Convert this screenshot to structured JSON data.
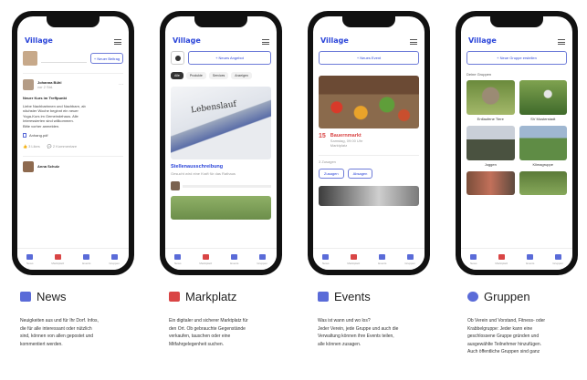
{
  "brand": {
    "logo": "Village",
    "accent": "#2b45d9",
    "red": "#d94545"
  },
  "tabs": [
    "News",
    "Marktplatz",
    "Events",
    "Gruppen"
  ],
  "phone1": {
    "composer_button": "+ Neuer Beitrag",
    "post": {
      "author": "Johanna Bühl",
      "time": "vor 2 Std.",
      "title": "Neuer Kurs im Treffpunkt",
      "lines": [
        "Liebe Nachbarinnen und Nachbarn, ab",
        "nächster Woche beginnt ein neuer",
        "Yoga-Kurs im Gemeindehaus. Alle",
        "Interessierten sind willkommen.",
        "Bitte vorher anmelden."
      ],
      "attachment": "Anhang.pdf",
      "likes": "3 Likes",
      "comments": "2 Kommentare"
    },
    "post2_author": "Anna Schulz"
  },
  "phone2": {
    "new_button": "+ Neues Angebot",
    "chips": [
      "Alle",
      "Produkte",
      "Services",
      "Anzeigen"
    ],
    "photo_sign": "Lebenslauf",
    "card_title": "Stellenausschreibung",
    "card_sub": "Gesucht wird eine Kraft für das Rathaus"
  },
  "phone3": {
    "new_button": "+ Neues Event",
    "event_day": "15",
    "event_title": "Bauernmarkt",
    "event_meta": [
      "Samstag, 09:00 Uhr",
      "Marktplatz"
    ],
    "attendees": "3 Zusagen",
    "btn_yes": "Zusagen",
    "btn_no": "Absagen"
  },
  "phone4": {
    "new_button": "+ Neue Gruppe erstellen",
    "section_label": "Deine Gruppen",
    "groups": [
      "Entlaufene Tiere",
      "SV Musterstadt",
      "Joggen",
      "Klimagruppe",
      "",
      ""
    ]
  },
  "sections": [
    {
      "title": "News",
      "text": [
        "Neuigkeiten aus und für Ihr Dorf. Infos,",
        "die für alle interessant oder nützlich",
        "sind, können von allen gepostet und",
        "kommentiert werden."
      ]
    },
    {
      "title": "Markplatz",
      "text": [
        "Ein digitaler und sicherer Marktplatz für",
        "den Ort. Ob gebrauchte Gegenstände",
        "verkaufen, tauschen oder eine",
        "Mitfahrgelegenheit suchen."
      ]
    },
    {
      "title": "Events",
      "text": [
        "Was ist wann und wo los?",
        "Jeder Verein, jede Gruppe und auch die",
        "Verwaltung können ihre Events teilen,",
        "alle können zusagen."
      ]
    },
    {
      "title": "Gruppen",
      "text": [
        "Ob Verein und Vorstand, Fitness- oder",
        "Krabbelgruppe: Jeder kann eine",
        "geschlossene Gruppe gründen und",
        "ausgewählte Teilnehmer hinzufügen.",
        "Auch öffentliche Gruppen sind ganz"
      ]
    }
  ]
}
